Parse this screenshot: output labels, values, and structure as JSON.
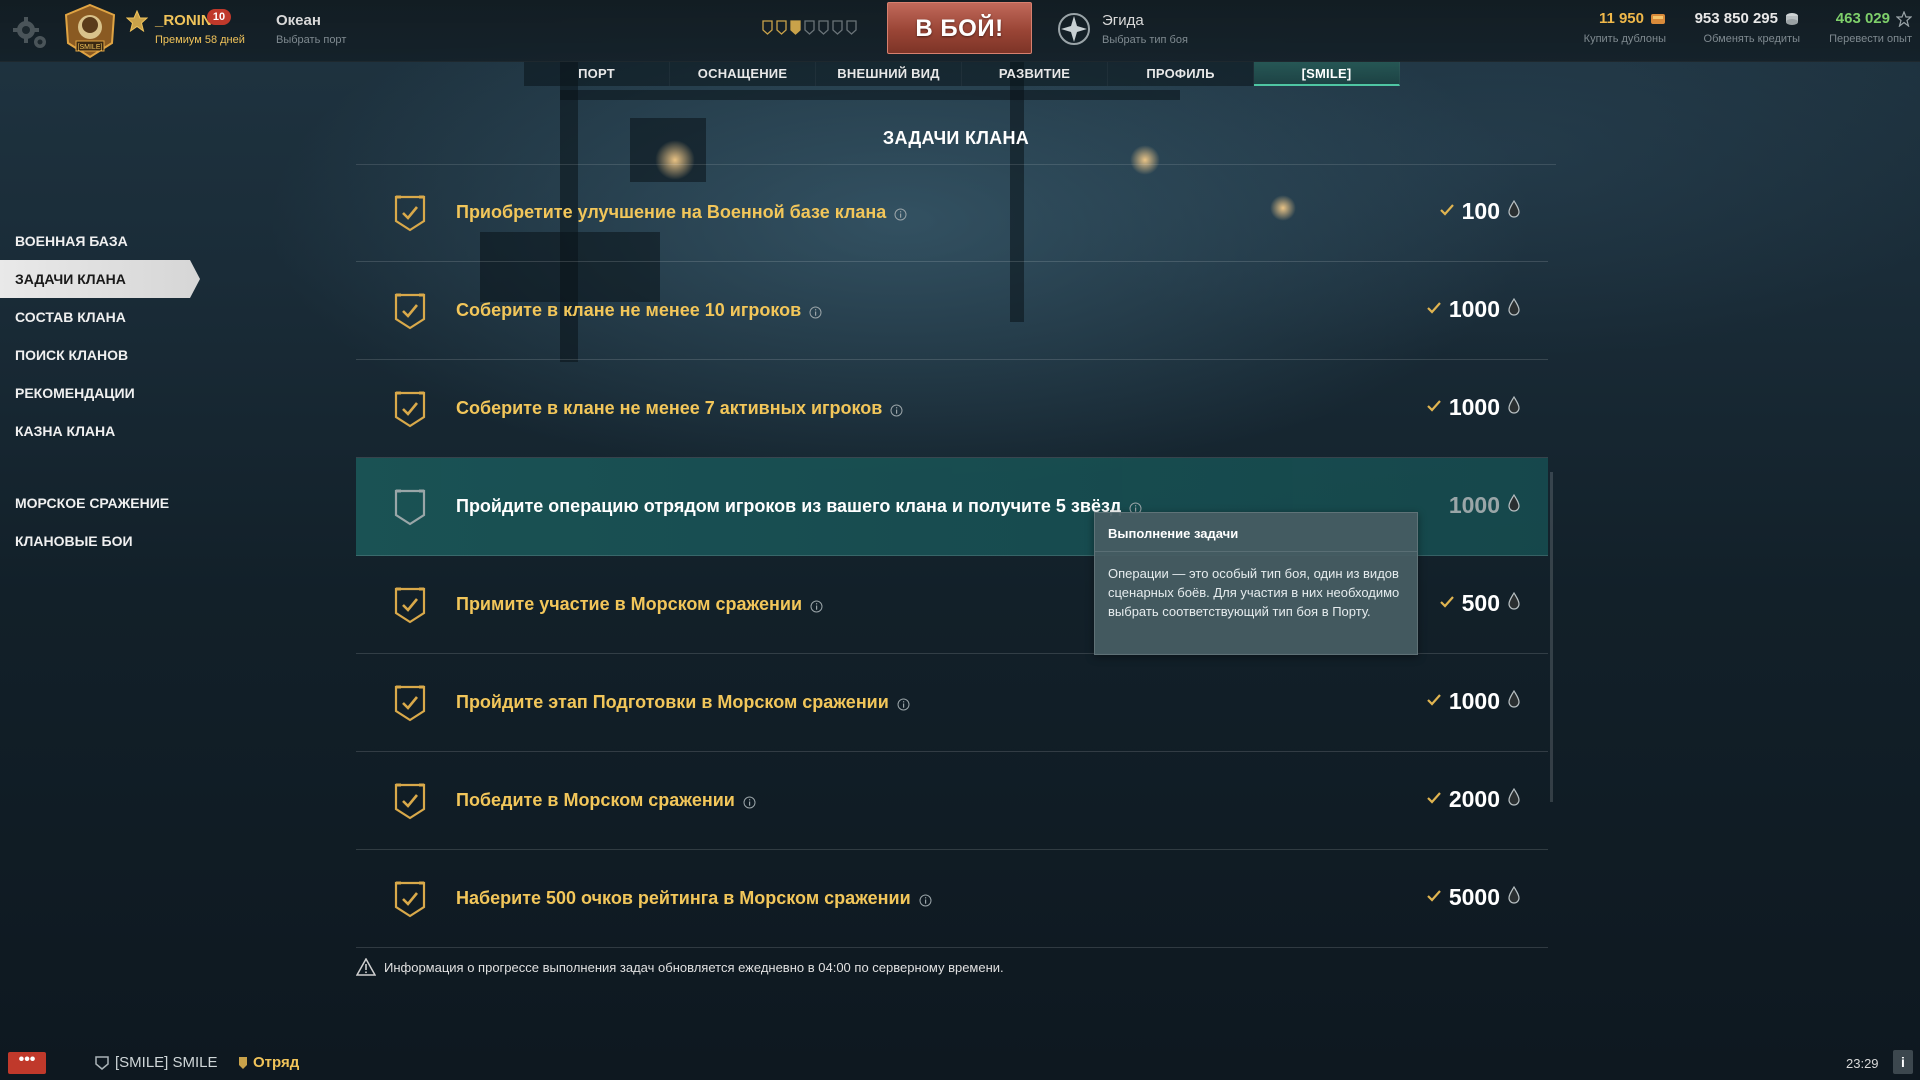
{
  "player": {
    "name": "_RONIN",
    "level": "10",
    "premium": "Премиум 58 дней",
    "emblem_tag": "[SMILE]"
  },
  "port": {
    "name": "Океан",
    "sub": "Выбрать порт"
  },
  "battle_button": "В БОЙ!",
  "battle_mode": {
    "name": "Эгида",
    "sub": "Выбрать тип боя"
  },
  "resources": {
    "doubloons": {
      "value": "11 950",
      "sub": "Купить дублоны",
      "color": "#f0b84a"
    },
    "credits": {
      "value": "953 850 295",
      "sub": "Обменять кредиты",
      "color": "#e8e8e8"
    },
    "free_xp": {
      "value": "463 029",
      "sub": "Перевести опыт",
      "color": "#7ecf6a"
    }
  },
  "tabs": [
    {
      "label": "ПОРТ"
    },
    {
      "label": "ОСНАЩЕНИЕ"
    },
    {
      "label": "ВНЕШНИЙ ВИД"
    },
    {
      "label": "РАЗВИТИЕ"
    },
    {
      "label": "ПРОФИЛЬ"
    },
    {
      "label": "[SMILE]",
      "active": true
    }
  ],
  "sidebar": {
    "items": [
      {
        "label": "ВОЕННАЯ БАЗА"
      },
      {
        "label": "ЗАДАЧИ КЛАНА",
        "active": true
      },
      {
        "label": "СОСТАВ КЛАНА"
      },
      {
        "label": "ПОИСК КЛАНОВ"
      },
      {
        "label": "РЕКОМЕНДАЦИИ"
      },
      {
        "label": "КАЗНА КЛАНА"
      }
    ],
    "items2": [
      {
        "label": "МОРСКОЕ СРАЖЕНИЕ"
      },
      {
        "label": "КЛАНОВЫЕ БОИ"
      }
    ]
  },
  "section_title": "ЗАДАЧИ КЛАНА",
  "tasks": [
    {
      "title": "Приобретите улучшение на Военной базе клана",
      "reward": "100",
      "completed": true
    },
    {
      "title": "Соберите в клане не менее 10 игроков",
      "reward": "1000",
      "completed": true
    },
    {
      "title": "Соберите в клане не менее 7 активных игроков",
      "reward": "1000",
      "completed": true
    },
    {
      "title": "Пройдите операцию отрядом игроков из вашего клана и получите 5 звёзд",
      "reward": "1000",
      "completed": false
    },
    {
      "title": "Примите участие в Морском сражении",
      "reward": "500",
      "completed": true
    },
    {
      "title": "Пройдите этап Подготовки в Морском сражении",
      "reward": "1000",
      "completed": true
    },
    {
      "title": "Победите в Морском сражении",
      "reward": "2000",
      "completed": true
    },
    {
      "title": "Наберите 500 очков рейтинга в Морском сражении",
      "reward": "5000",
      "completed": true
    }
  ],
  "tooltip": {
    "title": "Выполнение задачи",
    "body": "Операции — это особый тип боя, один из видов сценарных боёв. Для участия в них необходимо выбрать соответствующий тип боя в Порту."
  },
  "note": "Информация о прогрессе выполнения задач обновляется ежедневно в 04:00 по серверному времени.",
  "bottom": {
    "chat": "•••",
    "clan": "[SMILE] SMILE",
    "squad": "Отряд",
    "time": "23:29",
    "info": "i"
  },
  "colors": {
    "accent_gold": "#f2c65a",
    "active_row": "#1a5456",
    "battle_button": "#9a4536",
    "active_tab_border": "#4fc6a3"
  }
}
